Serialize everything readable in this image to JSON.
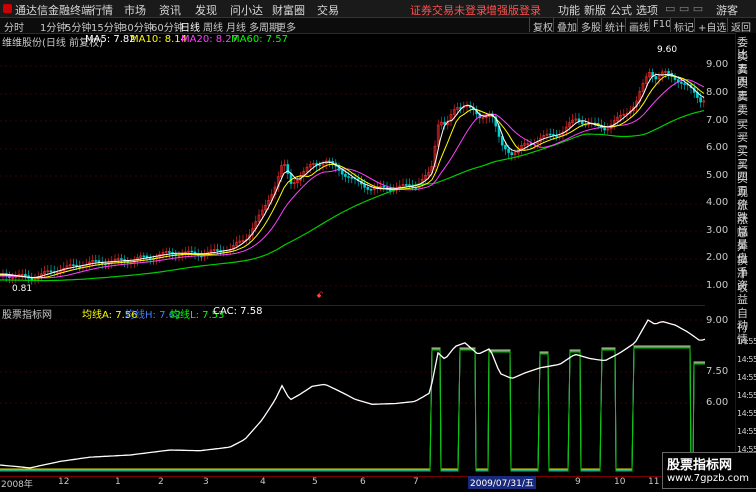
{
  "app": {
    "title": "通达信金融终端"
  },
  "menu": {
    "items": [
      "行情",
      "市场",
      "资讯",
      "发现",
      "问小达",
      "财富圈",
      "交易"
    ],
    "notice": "证券交易未登录",
    "login": "增强版登录",
    "right": [
      "功能",
      "新版",
      "公式",
      "选项"
    ],
    "guest": "游客"
  },
  "toolbar": {
    "periods": [
      "分时",
      "1分钟",
      "5分钟",
      "15分钟",
      "30分钟",
      "60分钟",
      "日线",
      "周线",
      "月线",
      "多周期",
      "更多"
    ],
    "active_period": "日线",
    "right_buttons": [
      "复权",
      "叠加",
      "多股",
      "统计",
      "画线",
      "F10",
      "标记",
      "+自选",
      "返回"
    ]
  },
  "main_legend": {
    "stock": "维维股份(日线 前复权)",
    "ma5": "MA5: 7.82",
    "ma10": "MA10: 8.14",
    "ma20": "MA20: 8.27",
    "ma60": "MA60: 7.57",
    "high_marker": "9.60",
    "low_marker": "0.81",
    "colors": {
      "ma5": "#ffffff",
      "ma10": "#ffff00",
      "ma20": "#ff40ff",
      "ma60": "#00ff00",
      "up": "#ff3030",
      "down": "#00e0e0"
    }
  },
  "main_axis": [
    "9.00",
    "8.00",
    "7.00",
    "6.00",
    "5.00",
    "4.00",
    "3.00",
    "2.00",
    "1.00"
  ],
  "indicator_legend": {
    "name": "股票指标网",
    "a": "均线A: 7.56",
    "h": "均线H: 7.62",
    "l": "均线L: 7.53",
    "cac": "CAC: 7.58",
    "colors": {
      "a": "#ffff00",
      "h": "#4080ff",
      "l": "#00ff00",
      "cac": "#ffffff"
    }
  },
  "indicator_axis": [
    "9.00",
    "7.50",
    "6.00"
  ],
  "sidebar": [
    "委比",
    "卖五",
    "卖四",
    "卖三",
    "卖二",
    "卖一",
    "买一",
    "买二",
    "买三",
    "买四",
    "买五",
    "现价",
    "涨跌",
    "涨幅",
    "总量",
    "外盘",
    "换手",
    "净资",
    "收益",
    "自动",
    "行情",
    "14:55",
    "14:55",
    "14:55",
    "14:55",
    "14:55",
    "14:55",
    "14:55",
    "14:55",
    "14:55"
  ],
  "dates": [
    "2008年",
    "12",
    "1",
    "2",
    "3",
    "4",
    "5",
    "6",
    "7",
    "8",
    "9",
    "10",
    "11"
  ],
  "date_cursor": "2009/07/31/五",
  "watermark": {
    "title": "股票指标网",
    "url": "www.7gpzb.com"
  }
}
